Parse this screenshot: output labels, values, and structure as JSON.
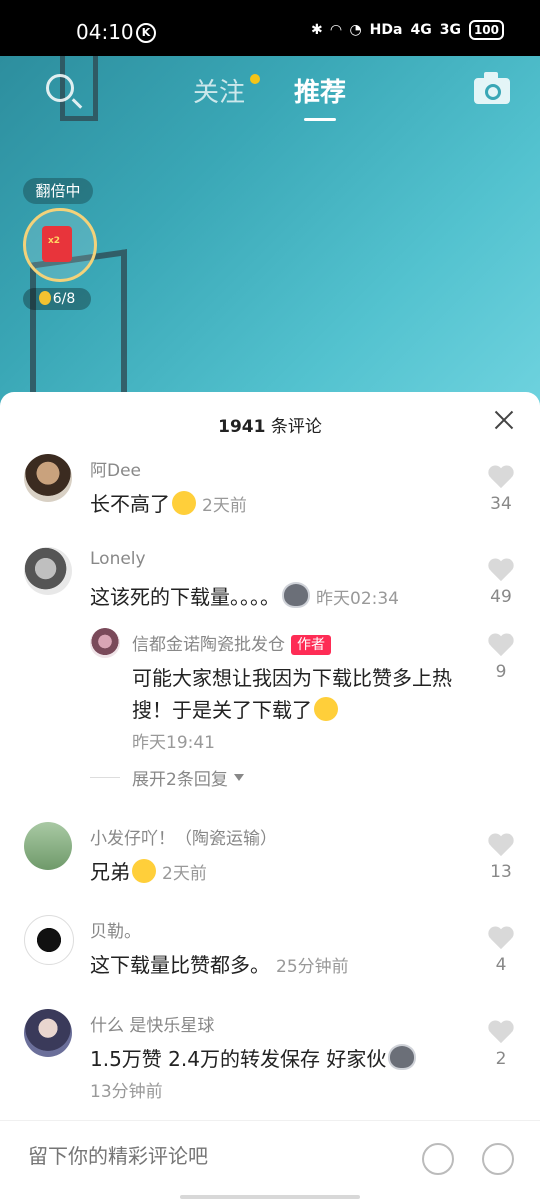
{
  "status_bar": {
    "time": "04:10",
    "k_badge": "K",
    "network": "HDa",
    "signal1": "4G",
    "signal2": "3G",
    "battery": "100"
  },
  "top_nav": {
    "follow_label": "关注",
    "recommend_label": "推荐"
  },
  "reward": {
    "badge": "翻倍中",
    "count": "6/8"
  },
  "comments_sheet": {
    "count": "1941",
    "title_suffix": " 条评论",
    "comments": [
      {
        "username": "阿Dee",
        "text": "长不高了",
        "time": "2天前",
        "likes": "34"
      },
      {
        "username": "Lonely",
        "text": "这该死的下载量。。。。",
        "time": "昨天02:34",
        "likes": "49"
      },
      {
        "username": "小发仔吖！（陶瓷运输）",
        "text": "兄弟",
        "time": "2天前",
        "likes": "13"
      },
      {
        "username": "贝勒。",
        "text": "这下载量比赞都多。",
        "time": "25分钟前",
        "likes": "4"
      },
      {
        "username": "什么 是快乐星球",
        "text": "1.5万赞 2.4万的转发保存 好家伙",
        "time": "13分钟前",
        "likes": "2"
      }
    ],
    "reply": {
      "username": "信都金诺陶瓷批发仓",
      "badge": "作者",
      "text": "可能大家想让我因为下载比赞多上热搜！于是关了下载了",
      "time": "昨天19:41",
      "likes": "9"
    },
    "expand_label": "展开2条回复"
  },
  "input_bar": {
    "placeholder": "留下你的精彩评论吧"
  }
}
